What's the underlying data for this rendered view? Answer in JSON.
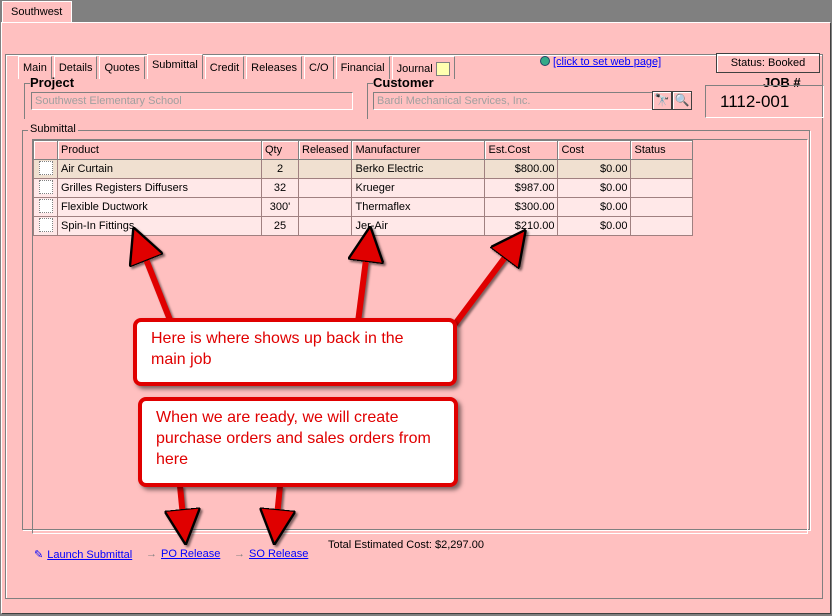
{
  "window": {
    "tab_label": "Southwest"
  },
  "tabs": [
    "Main",
    "Details",
    "Quotes",
    "Submittal",
    "Credit",
    "Releases",
    "C/O",
    "Financial",
    "Journal"
  ],
  "active_tab": "Submittal",
  "web_link": "[click to set web page]",
  "status": "Status: Booked",
  "project": {
    "label": "Project",
    "value": "Southwest Elementary School"
  },
  "customer": {
    "label": "Customer",
    "value": "Bardi Mechanical Services, Inc."
  },
  "job": {
    "label": "JOB #",
    "value": "1112-001"
  },
  "submittal": {
    "group_label": "Submittal",
    "columns": [
      "",
      "Product",
      "Qty",
      "Released",
      "Manufacturer",
      "Est.Cost",
      "Cost",
      "Status"
    ],
    "rows": [
      {
        "product": "Air Curtain",
        "qty": "2",
        "released": "",
        "manufacturer": "Berko Electric",
        "est_cost": "$800.00",
        "cost": "$0.00",
        "status": ""
      },
      {
        "product": "Grilles Registers Diffusers",
        "qty": "32",
        "released": "",
        "manufacturer": "Krueger",
        "est_cost": "$987.00",
        "cost": "$0.00",
        "status": ""
      },
      {
        "product": "Flexible Ductwork",
        "qty": "300'",
        "released": "",
        "manufacturer": "Thermaflex",
        "est_cost": "$300.00",
        "cost": "$0.00",
        "status": ""
      },
      {
        "product": "Spin-In Fittings",
        "qty": "25",
        "released": "",
        "manufacturer": "Jer-Air",
        "est_cost": "$210.00",
        "cost": "$0.00",
        "status": ""
      }
    ],
    "total_label": "Total Estimated Cost:",
    "total_value": "$2,297.00"
  },
  "links": {
    "launch": "Launch Submittal",
    "po": "PO Release",
    "so": "SO Release"
  },
  "callouts": {
    "top": "Here is where shows up back in the main job",
    "bottom": "When we are ready, we will create purchase orders and sales orders from here"
  },
  "colors": {
    "background": "#ffc0c0",
    "callout_red": "#e00000",
    "link": "#0000ff"
  }
}
